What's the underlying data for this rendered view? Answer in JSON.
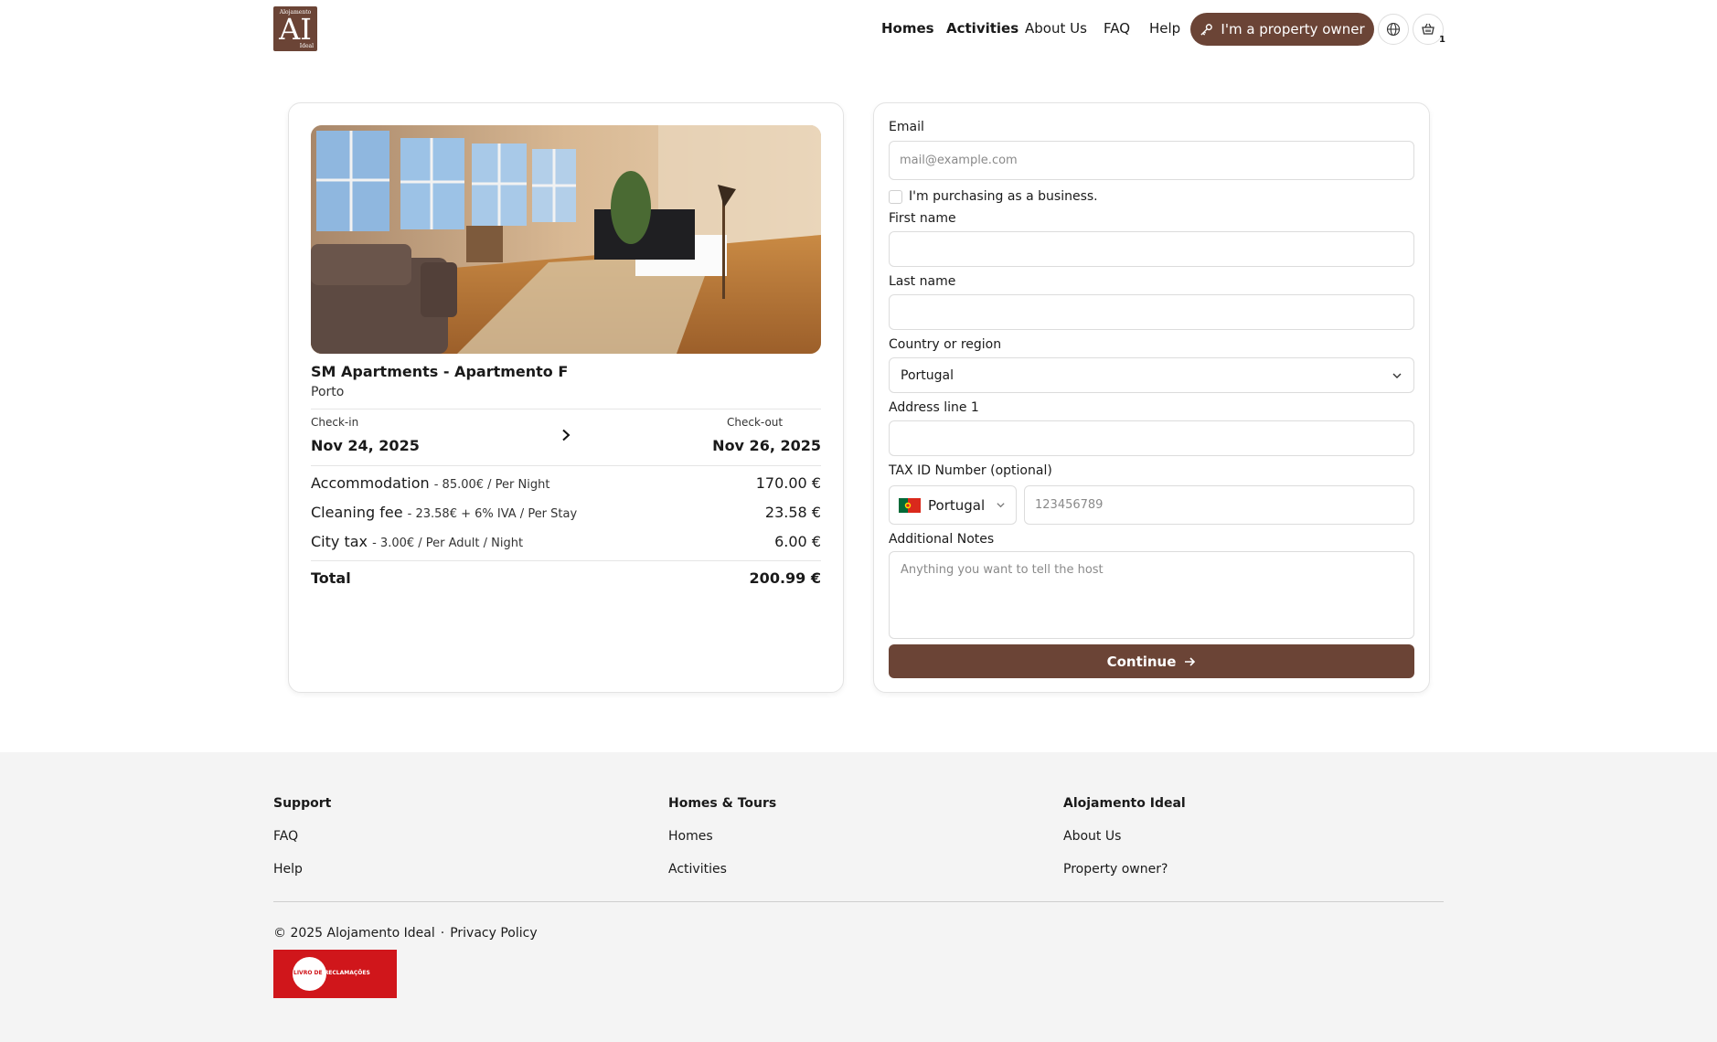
{
  "header": {
    "logo": {
      "top": "Alojamento",
      "main": "AI",
      "bottom": "Ideal"
    },
    "nav": [
      "Homes",
      "Activities",
      "About Us",
      "FAQ",
      "Help"
    ],
    "owner_button": "I'm a property owner",
    "cart_count": "1",
    "icons": {
      "owner": "key-icon",
      "language": "globe-icon",
      "cart": "basket-icon"
    }
  },
  "property": {
    "title": "SM Apartments - Apartmento F",
    "city": "Porto",
    "checkin_label": "Check-in",
    "checkin_date": "Nov 24, 2025",
    "checkout_label": "Check-out",
    "checkout_date": "Nov 26, 2025",
    "lines": [
      {
        "label": "Accommodation",
        "detail": "- 85.00€ / Per Night",
        "amount": "170.00 €"
      },
      {
        "label": "Cleaning fee",
        "detail": "- 23.58€ + 6% IVA / Per Stay",
        "amount": "23.58 €"
      },
      {
        "label": "City tax",
        "detail": "- 3.00€ / Per Adult / Night",
        "amount": "6.00 €"
      }
    ],
    "total_label": "Total",
    "total_amount": "200.99 €"
  },
  "form": {
    "email_label": "Email",
    "email_placeholder": "mail@example.com",
    "business_label": "I'm purchasing as a business.",
    "first_name_label": "First name",
    "last_name_label": "Last name",
    "country_label": "Country or region",
    "country_value": "Portugal",
    "address_label": "Address line 1",
    "tax_label": "TAX ID Number (optional)",
    "tax_country": "Portugal",
    "tax_placeholder": "123456789",
    "notes_label": "Additional Notes",
    "notes_placeholder": "Anything you want to tell the host",
    "continue_label": "Continue"
  },
  "footer": {
    "columns": [
      {
        "title": "Support",
        "links": [
          "FAQ",
          "Help"
        ]
      },
      {
        "title": "Homes & Tours",
        "links": [
          "Homes",
          "Activities"
        ]
      },
      {
        "title": "Alojamento Ideal",
        "links": [
          "About Us",
          "Property owner?"
        ]
      }
    ],
    "copyright": "© 2025 Alojamento Ideal",
    "privacy": "Privacy Policy",
    "badge_a": "LIVRO DE",
    "badge_b": "RECLAMAÇÕES"
  },
  "colors": {
    "brand": "#6b4436",
    "badge_red": "#d0161b",
    "footer_bg": "#f4f4f4"
  }
}
